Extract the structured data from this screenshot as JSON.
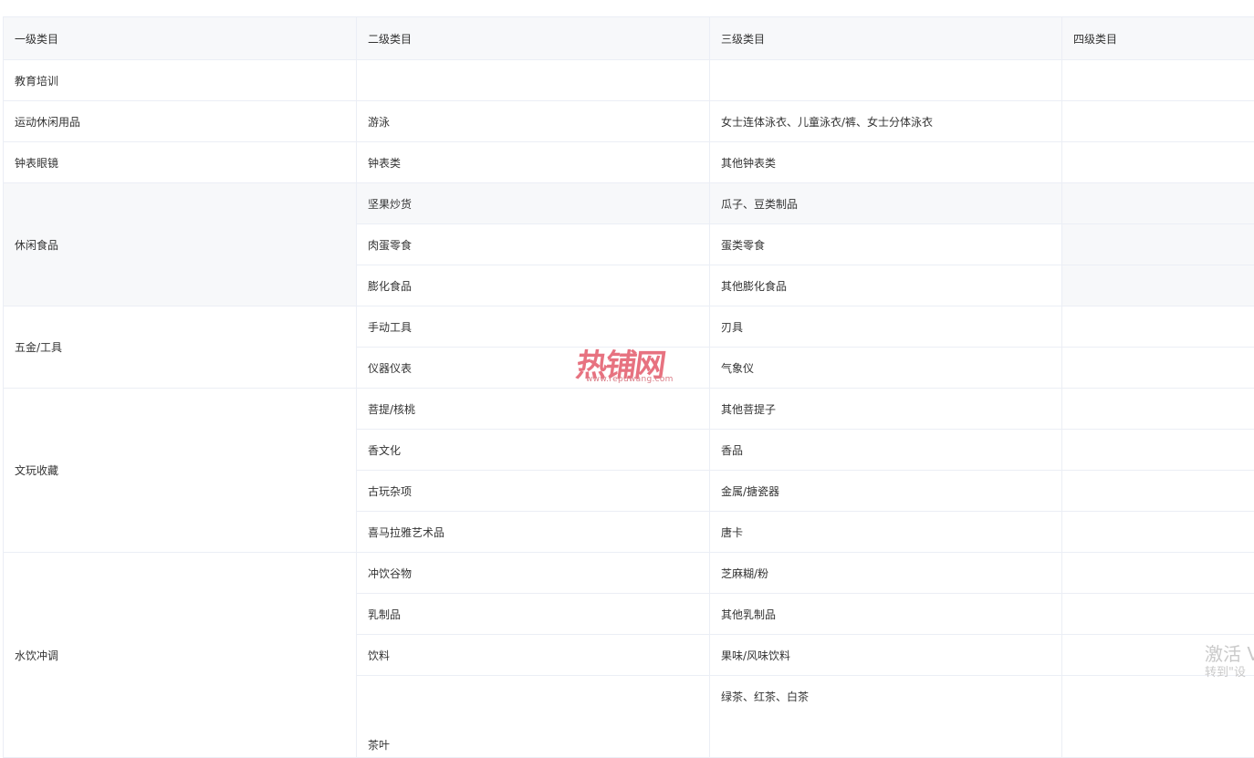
{
  "table": {
    "headers": [
      "一级类目",
      "二级类目",
      "三级类目",
      "四级类目"
    ],
    "rows": {
      "r0": {
        "c1": "教育培训",
        "c2": "",
        "c3": "",
        "c4": ""
      },
      "r1": {
        "c1": "运动休闲用品",
        "c2": "游泳",
        "c3": "女士连体泳衣、儿童泳衣/裤、女士分体泳衣",
        "c4": ""
      },
      "r2": {
        "c1": "钟表眼镜",
        "c2": "钟表类",
        "c3": "其他钟表类",
        "c4": ""
      },
      "r3": {
        "c1": "休闲食品",
        "c2": "坚果炒货",
        "c3": "瓜子、豆类制品",
        "c4": ""
      },
      "r4": {
        "c2": "肉蛋零食",
        "c3": "蛋类零食",
        "c4": ""
      },
      "r5": {
        "c2": "膨化食品",
        "c3": "其他膨化食品",
        "c4": ""
      },
      "r6": {
        "c1": "五金/工具",
        "c2": "手动工具",
        "c3": "刃具",
        "c4": ""
      },
      "r7": {
        "c2": "仪器仪表",
        "c3": "气象仪",
        "c4": ""
      },
      "r8": {
        "c1": "文玩收藏",
        "c2": "菩提/核桃",
        "c3": "其他菩提子",
        "c4": ""
      },
      "r9": {
        "c2": "香文化",
        "c3": "香品",
        "c4": ""
      },
      "r10": {
        "c2": "古玩杂项",
        "c3": "金属/搪瓷器",
        "c4": ""
      },
      "r11": {
        "c2": "喜马拉雅艺术品",
        "c3": "唐卡",
        "c4": ""
      },
      "r12": {
        "c1": "水饮冲调",
        "c2": "冲饮谷物",
        "c3": "芝麻糊/粉",
        "c4": ""
      },
      "r13": {
        "c2": "乳制品",
        "c3": "其他乳制品",
        "c4": ""
      },
      "r14": {
        "c2": "饮料",
        "c3": "果味/风味饮料",
        "c4": ""
      },
      "r15": {
        "c2": "茶叶",
        "c3": "绿茶、红茶、白茶",
        "c4": ""
      }
    }
  },
  "watermark": {
    "main": "热铺网",
    "sub": "www.repuwang.com"
  },
  "activation": {
    "line1": "激活 V",
    "line2": "转到\"设"
  }
}
